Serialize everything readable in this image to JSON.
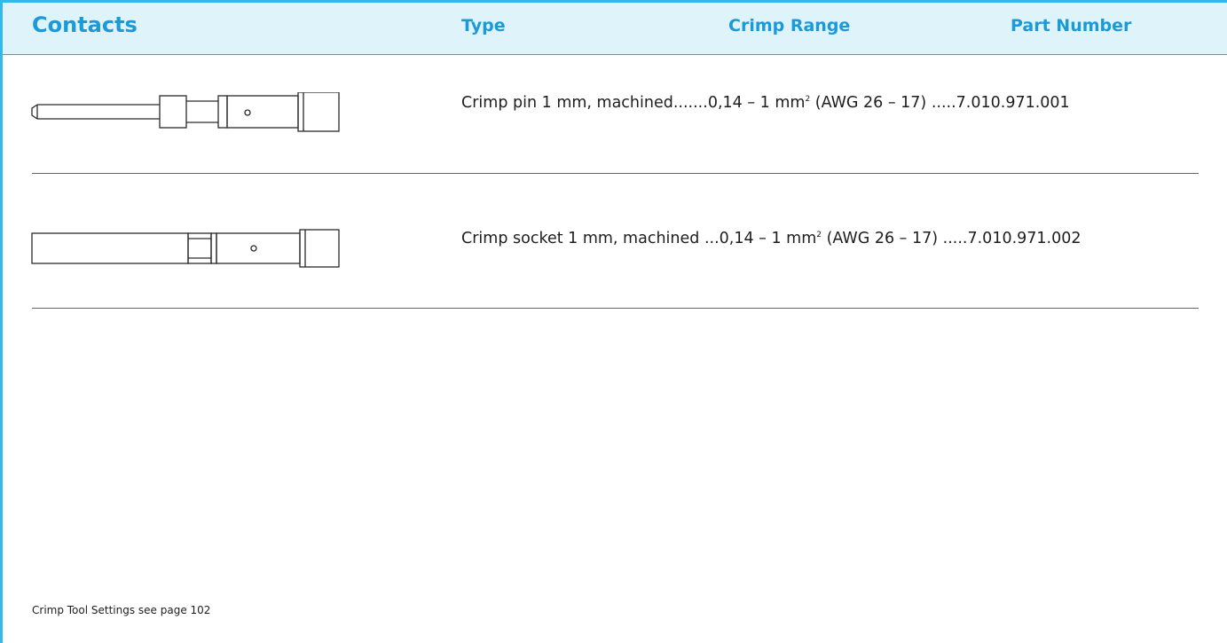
{
  "header": {
    "title": "Contacts",
    "col_type": "Type",
    "col_crimp_range": "Crimp Range",
    "col_part_number": "Part Number"
  },
  "rows": [
    {
      "type": "Crimp pin 1 mm, machined",
      "type_leader": ".......",
      "range_prefix": "0,14 – 1 mm",
      "range_sup": "2",
      "range_suffix": " (AWG 26 – 17)",
      "part_leader": " .....",
      "part_number": "7.010.971.001"
    },
    {
      "type": "Crimp socket 1 mm, machined",
      "type_leader": " ...",
      "range_prefix": "0,14 – 1 mm",
      "range_sup": "2",
      "range_suffix": " (AWG 26 – 17) ",
      "part_leader": ".....",
      "part_number": "7.010.971.002"
    }
  ],
  "footnote": "Crimp Tool Settings see page 102",
  "colors": {
    "accent": "#1a9ad8",
    "frame": "#33b8ea",
    "header_band": "#dff3fb"
  }
}
